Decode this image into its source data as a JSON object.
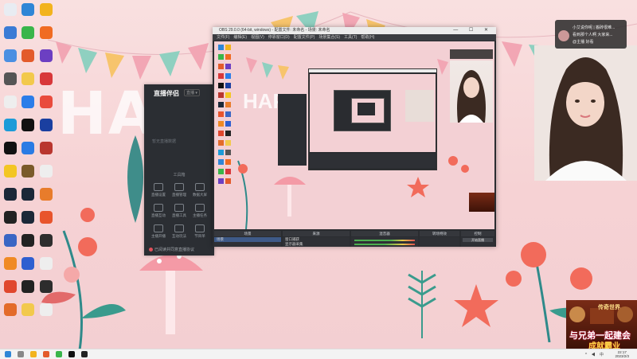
{
  "wallpaper": {
    "happy_text": "HAPP",
    "preview_happy_text": "HAP"
  },
  "desktop_icons": [
    {
      "label": "",
      "color": "#e8ecf2"
    },
    {
      "label": "",
      "color": "#2f86d6"
    },
    {
      "label": "",
      "color": "#f2b31d"
    },
    {
      "label": "",
      "color": "#3a7bd5"
    },
    {
      "label": "",
      "color": "#39b54a"
    },
    {
      "label": "",
      "color": "#f06b22"
    },
    {
      "label": "",
      "color": "#4b8fe2"
    },
    {
      "label": "",
      "color": "#e35b2b"
    },
    {
      "label": "",
      "color": "#6c3fc2"
    },
    {
      "label": "",
      "color": "#555"
    },
    {
      "label": "",
      "color": "#f2c94c"
    },
    {
      "label": "",
      "color": "#d8383a"
    },
    {
      "label": "",
      "color": "#eee"
    },
    {
      "label": "",
      "color": "#2b7de9"
    },
    {
      "label": "",
      "color": "#e94b3c"
    },
    {
      "label": "",
      "color": "#1c9bd8"
    },
    {
      "label": "",
      "color": "#111"
    },
    {
      "label": "",
      "color": "#1a3fa0"
    },
    {
      "label": "",
      "color": "#111"
    },
    {
      "label": "",
      "color": "#2a7be4"
    },
    {
      "label": "",
      "color": "#b9362e"
    },
    {
      "label": "",
      "color": "#f3c623"
    },
    {
      "label": "",
      "color": "#7a5a2a"
    },
    {
      "label": "",
      "color": "#eee"
    },
    {
      "label": "",
      "color": "#1b2838"
    },
    {
      "label": "",
      "color": "#1b2838"
    },
    {
      "label": "",
      "color": "#e87c2b"
    },
    {
      "label": "",
      "color": "#222"
    },
    {
      "label": "",
      "color": "#1b2838"
    },
    {
      "label": "",
      "color": "#e8542c"
    },
    {
      "label": "",
      "color": "#3a66c4"
    },
    {
      "label": "",
      "color": "#222"
    },
    {
      "label": "",
      "color": "#2e2e2e"
    },
    {
      "label": "",
      "color": "#f08a24"
    },
    {
      "label": "",
      "color": "#2f5fd0"
    },
    {
      "label": "",
      "color": "#eee"
    },
    {
      "label": "",
      "color": "#e0472e"
    },
    {
      "label": "",
      "color": "#222"
    },
    {
      "label": "",
      "color": "#2d2d2d"
    },
    {
      "label": "",
      "color": "#e36b2a"
    },
    {
      "label": "",
      "color": "#f2c94c"
    },
    {
      "label": "",
      "color": "#eee"
    }
  ],
  "assistant": {
    "title": "直播伴侣",
    "badge": "直播 ▾",
    "empty_text": "暂无直播数据",
    "tools_title": "工具箱",
    "tools": [
      "直播设置",
      "直播管理",
      "数据大屏",
      "直播互动",
      "直播工具",
      "主播任务",
      "主播开播",
      "互动玩法",
      "节目单"
    ],
    "agreement": "已阅读并同意直播协议"
  },
  "obs": {
    "title": "OBS 29.0.0 (64-bit, windows) - 配置文件: 未命名 - 场景: 未命名",
    "menus": [
      "文件(F)",
      "编辑(E)",
      "视图(V)",
      "停靠窗口(D)",
      "配置文件(P)",
      "场景集合(S)",
      "工具(T)",
      "帮助(H)"
    ],
    "docks": {
      "scenes_header": "场景",
      "sources_header": "来源",
      "mixer_header": "混音器",
      "transitions_header": "转场特效",
      "controls_header": "控制"
    },
    "scene_item": "场景",
    "sources": [
      "窗口捕获",
      "显示器采集",
      "视频采集设备",
      "图片"
    ],
    "controls": [
      "开始直播",
      "开始录制",
      "启动虚拟摄像机",
      "工作室模式",
      "设置",
      "退出"
    ],
    "status": "LIVE: 00:00:00  REC: 00:00:00  CPU: 2.9%, 30.00 fps"
  },
  "chat": {
    "lines": [
      "小艾说你呢 | 搬砖很难...",
      "看到那个人啊 大家来...",
      "@主播 好看"
    ]
  },
  "game_ad": {
    "logo": "传奇世界",
    "line1": "与兄弟一起建会",
    "line2": "成就霸业"
  },
  "taskbar": {
    "tray": "^ ◀ 中",
    "time": "22:17",
    "date": "2023/2/3"
  },
  "colors": {
    "wallpaper": "#f7d7d9",
    "obs_dark": "#2a2c30",
    "assistant_dark": "#2b2e33",
    "accent_red": "#e0505a"
  }
}
